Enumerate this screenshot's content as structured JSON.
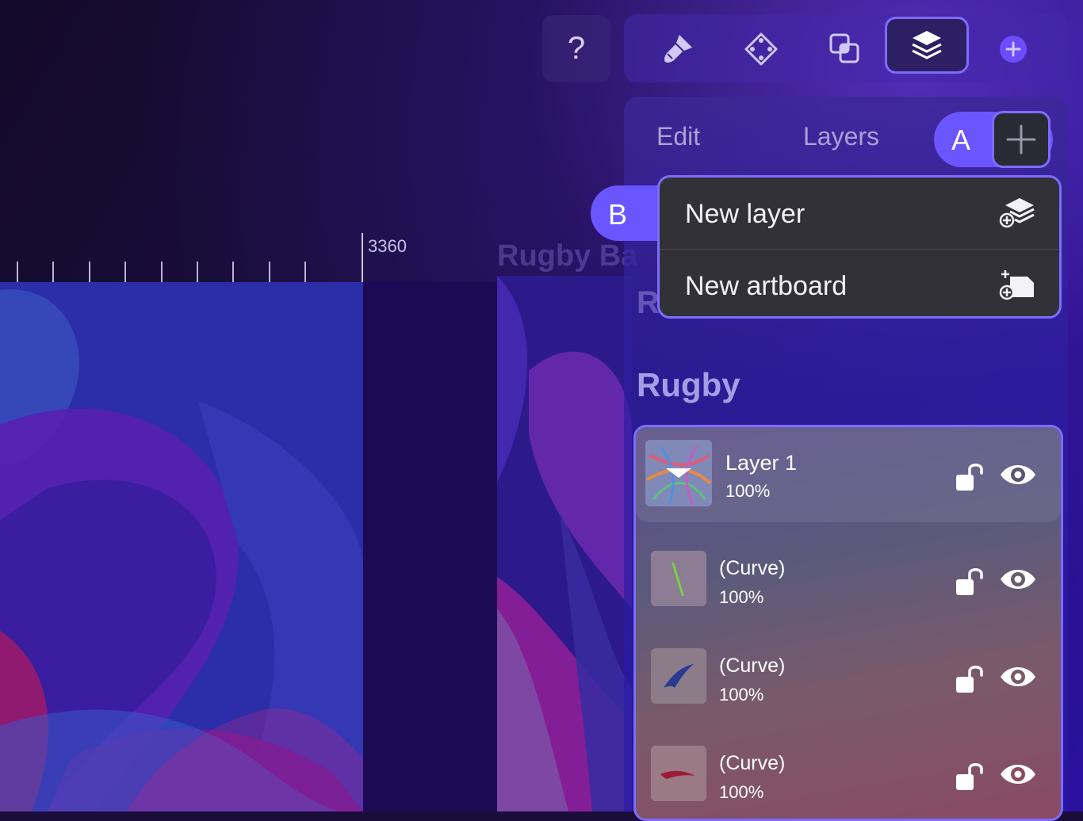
{
  "toolbar": {
    "help_label": "?",
    "tools": [
      "brush-icon",
      "transform-icon",
      "boolean-icon",
      "layers-icon",
      "add-circle-icon"
    ],
    "active_tool": "layers-icon"
  },
  "canvas": {
    "ruler_value": "3360",
    "artboard_title": "Rugby Ba"
  },
  "panel": {
    "tabs": {
      "edit": "Edit",
      "layers": "Layers"
    },
    "badge_a": "A",
    "badge_b": "B",
    "menu": {
      "new_layer": "New layer",
      "new_artboard": "New artboard"
    },
    "obscured_group": "R",
    "group_title": "Rugby",
    "layers": [
      {
        "name": "Layer 1",
        "opacity": "100%",
        "selected": true
      },
      {
        "name": "(Curve)",
        "opacity": "100%"
      },
      {
        "name": "(Curve)",
        "opacity": "100%"
      },
      {
        "name": "(Curve)",
        "opacity": "100%"
      }
    ]
  },
  "colors": {
    "accent": "#7d6cff",
    "badge": "#6b55ff",
    "menu_bg": "#323138"
  }
}
